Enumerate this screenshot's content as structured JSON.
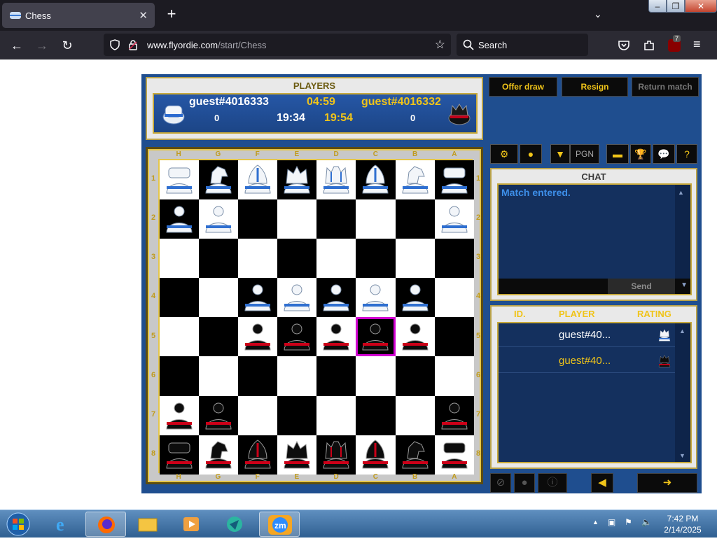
{
  "browser": {
    "tab_title": "Chess",
    "url_host": "www.flyordie.com",
    "url_path": "/start/Chess",
    "search_placeholder": "Search",
    "extension_badge": "7"
  },
  "players": {
    "title": "PLAYERS",
    "left": {
      "name": "guest#4016333",
      "score": "0",
      "timer": "04:59",
      "total": "19:34"
    },
    "right": {
      "name": "guest#4016332",
      "score": "0",
      "timer": "19:54"
    }
  },
  "buttons": {
    "offer_draw": "Offer draw",
    "resign": "Resign",
    "return_match": "Return match",
    "pgn": "PGN",
    "send": "Send"
  },
  "board": {
    "files": [
      "H",
      "G",
      "F",
      "E",
      "D",
      "C",
      "B",
      "A"
    ],
    "ranks": [
      "1",
      "2",
      "3",
      "4",
      "5",
      "6",
      "7",
      "8"
    ],
    "rows": [
      [
        "wR",
        "wN",
        "wB",
        "wK",
        "wQ",
        "wB",
        "wN",
        "wR"
      ],
      [
        "wP",
        "wP",
        "",
        "",
        "",
        "",
        "",
        "wP"
      ],
      [
        "",
        "",
        "",
        "",
        "",
        "",
        "",
        ""
      ],
      [
        "",
        "",
        "wP",
        "wP",
        "wP",
        "wP",
        "wP",
        ""
      ],
      [
        "",
        "",
        "bP",
        "bP",
        "bP",
        "bP",
        "bP",
        ""
      ],
      [
        "",
        "",
        "",
        "",
        "",
        "",
        "",
        ""
      ],
      [
        "bP",
        "bP",
        "",
        "",
        "",
        "",
        "",
        "bP"
      ],
      [
        "bR",
        "bN",
        "bB",
        "bK",
        "bQ",
        "bB",
        "bN",
        "bR"
      ]
    ],
    "highlight": {
      "row": 4,
      "col": 5
    }
  },
  "chat": {
    "title": "CHAT",
    "message": "Match entered."
  },
  "player_list": {
    "headers": {
      "id": "ID.",
      "player": "PLAYER",
      "rating": "RATING"
    },
    "rows": [
      {
        "name": "guest#40...",
        "color": "#ffffff",
        "side": "white"
      },
      {
        "name": "guest#40...",
        "color": "#f0c419",
        "side": "black"
      }
    ]
  },
  "taskbar": {
    "time": "7:42 PM",
    "date": "2/14/2025"
  },
  "colors": {
    "panel_blue": "#1f4e8f",
    "gold": "#f0c419",
    "highlight": "#d100d1"
  }
}
